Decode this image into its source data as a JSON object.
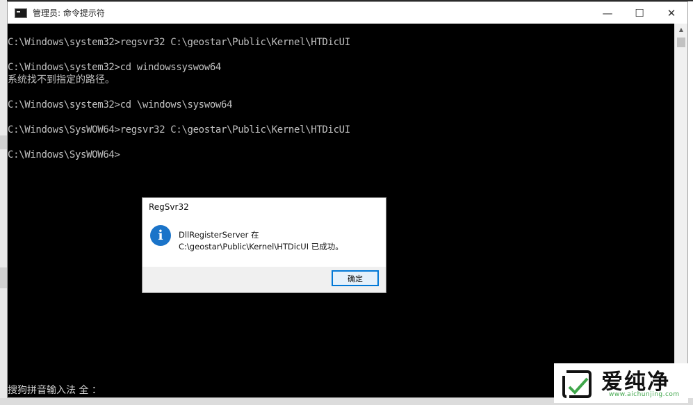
{
  "window": {
    "title": "管理员: 命令提示符",
    "minimize": "—",
    "maximize": "☐",
    "close": "✕"
  },
  "console": {
    "lines": [
      "C:\\Windows\\system32>regsvr32 C:\\geostar\\Public\\Kernel\\HTDicUI",
      "C:\\Windows\\system32>cd windowssyswow64",
      "系统找不到指定的路径。",
      "C:\\Windows\\system32>cd \\windows\\syswow64",
      "C:\\Windows\\SysWOW64>regsvr32 C:\\geostar\\Public\\Kernel\\HTDicUI",
      "C:\\Windows\\SysWOW64>"
    ],
    "ime_status": "搜狗拼音输入法 全 ："
  },
  "dialog": {
    "title": "RegSvr32",
    "icon": "info-icon",
    "message_line1": "DllRegisterServer 在",
    "message_line2": "C:\\geostar\\Public\\Kernel\\HTDicUI 已成功。",
    "ok_label": "确定"
  },
  "watermark": {
    "text": "爱纯净",
    "url": "www.aichunjing.com"
  }
}
